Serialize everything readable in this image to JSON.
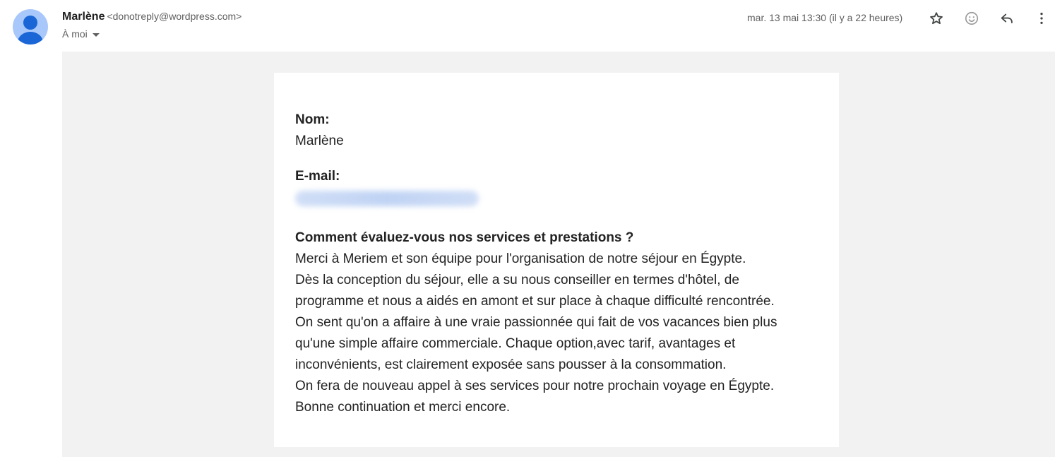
{
  "header": {
    "sender_name": "Marlène",
    "sender_email": "<donotreply@wordpress.com>",
    "recipient_label": "À moi",
    "date": "mar. 13 mai 13:30 (il y a 22 heures)"
  },
  "actions": {
    "star_icon": "star-icon",
    "emoji_icon": "emoji-reaction-icon",
    "reply_icon": "reply-icon",
    "more_icon": "more-vertical-icon"
  },
  "message": {
    "name_label": "Nom:",
    "name_value": "Marlène",
    "email_label": "E-mail:",
    "question_label": "Comment évaluez-vous nos services et prestations ?",
    "answer_lines": [
      "Merci à Meriem et son équipe pour l'organisation de notre séjour en Égypte.",
      "Dès la conception du séjour, elle a su nous conseiller en termes d'hôtel, de",
      "programme et nous a aidés en amont et sur place à chaque difficulté rencontrée.",
      "On sent qu'on a affaire à une vraie passionnée qui fait de vos vacances bien plus",
      "qu'une simple affaire commerciale. Chaque option,avec tarif, avantages et",
      "inconvénients, est clairement exposée sans pousser à la consommation.",
      "On fera de nouveau appel à ses services pour notre prochain voyage en Égypte.",
      "Bonne continuation et merci encore."
    ]
  },
  "colors": {
    "avatar_bg": "#a8c7fa",
    "avatar_fg": "#1a66d6",
    "content_bg": "#f2f2f2",
    "card_bg": "#ffffff"
  }
}
